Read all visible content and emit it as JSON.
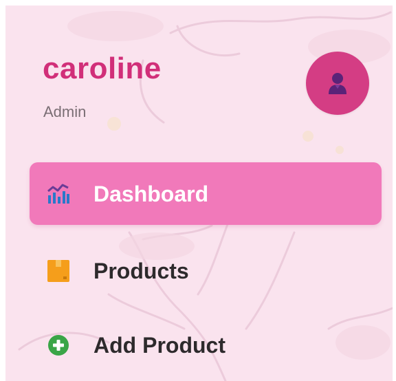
{
  "user": {
    "name": "caroline",
    "role": "Admin",
    "avatar_icon": "user-avatar-icon"
  },
  "nav": {
    "items": [
      {
        "label": "Dashboard",
        "icon": "chart-icon",
        "active": true
      },
      {
        "label": "Products",
        "icon": "package-icon",
        "active": false
      },
      {
        "label": "Add Product",
        "icon": "plus-circle-icon",
        "active": false
      }
    ]
  },
  "colors": {
    "panel_bg": "#fae3ee",
    "accent": "#d12f79",
    "active_item_bg": "#f179ba",
    "avatar_bg": "#d43d84"
  }
}
